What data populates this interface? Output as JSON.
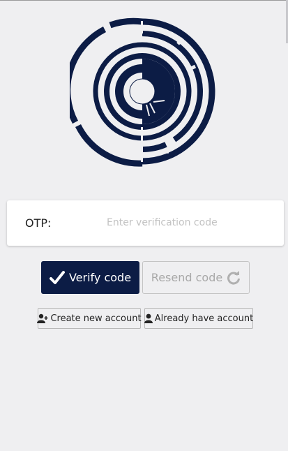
{
  "logo": {
    "icon": "circular-logo",
    "color": "#0c1c45"
  },
  "otp": {
    "label": "OTP:",
    "value": "",
    "placeholder": "Enter verification code"
  },
  "actions": {
    "verify_label": "Verify code",
    "verify_icon": "checkmark-icon",
    "resend_label": "Resend code",
    "resend_icon": "refresh-icon",
    "create_account_label": "Create new account",
    "create_account_icon": "add-user-icon",
    "have_account_label": "Already have account",
    "have_account_icon": "user-icon"
  },
  "colors": {
    "primary": "#0c1c45",
    "background": "#efeff1",
    "disabled_text": "#a8a8a8"
  }
}
